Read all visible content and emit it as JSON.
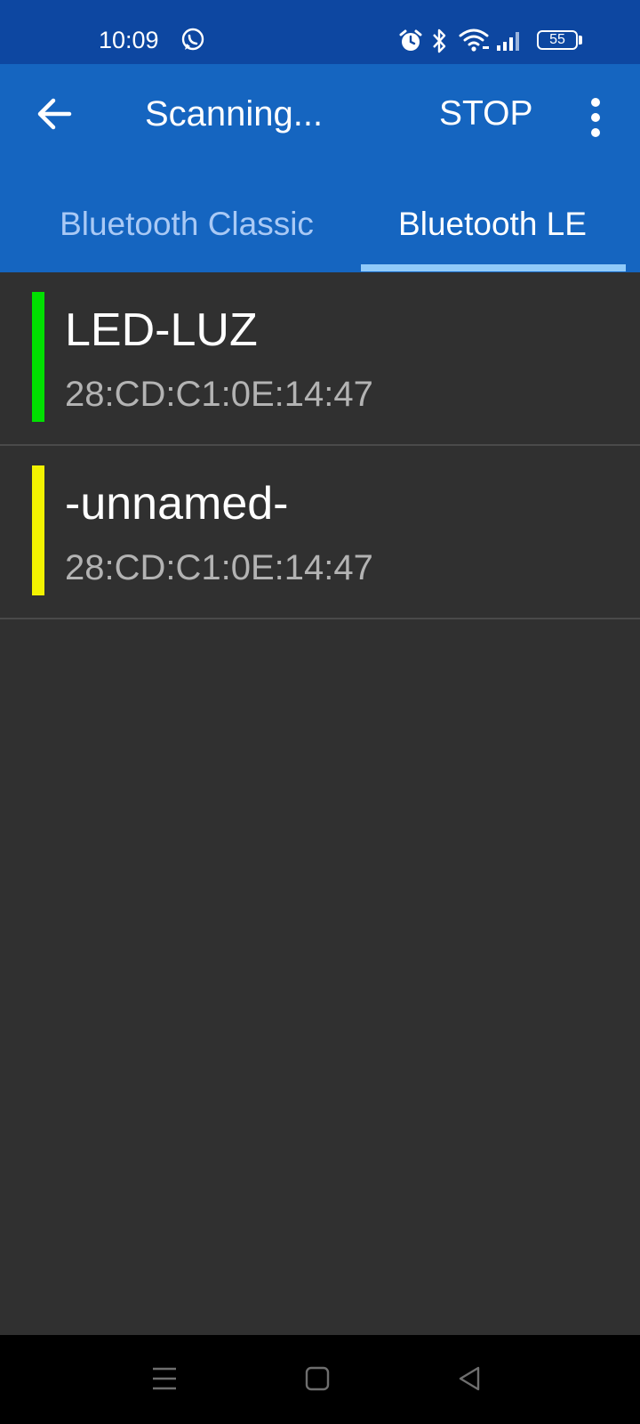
{
  "status_bar": {
    "time": "10:09",
    "battery": "55",
    "icons": [
      "whatsapp-icon",
      "alarm-icon",
      "bluetooth-icon",
      "wifi-icon",
      "signal-icon",
      "battery-icon"
    ]
  },
  "app_bar": {
    "title": "Scanning...",
    "stop_label": "STOP",
    "icons": [
      "back-arrow-icon",
      "more-vert-icon"
    ]
  },
  "tabs": [
    {
      "label": "Bluetooth Classic",
      "selected": false
    },
    {
      "label": "Bluetooth LE",
      "selected": true
    }
  ],
  "devices": [
    {
      "name": "LED-LUZ",
      "address": "28:CD:C1:0E:14:47",
      "signal_color": "#00e000"
    },
    {
      "name": "-unnamed-",
      "address": "28:CD:C1:0E:14:47",
      "signal_color": "#f2f200"
    }
  ],
  "colors": {
    "status_bar": "#0d47a1",
    "primary": "#1565c0",
    "tab_indicator": "#90caf9",
    "background": "#303030"
  },
  "nav_bar": {
    "icons": [
      "recent-apps-icon",
      "home-icon",
      "back-icon"
    ]
  }
}
